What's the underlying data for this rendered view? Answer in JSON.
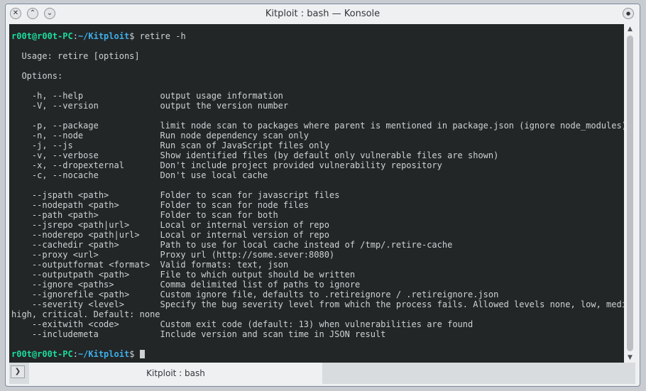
{
  "window": {
    "title": "Kitploit : bash — Konsole",
    "close_glyph": "✕",
    "minimize_glyph": "⌃",
    "maximize_glyph": "⌄",
    "keep_above_glyph": "●"
  },
  "prompt": {
    "user": "r00t@r00t-PC",
    "sep": ":",
    "path": "~/Kitploit",
    "symbol": "$",
    "command": "retire -h"
  },
  "output_lines": [
    "",
    "  Usage: retire [options]",
    "",
    "  Options:",
    "",
    "    -h, --help               output usage information",
    "    -V, --version            output the version number",
    "",
    "    -p, --package            limit node scan to packages where parent is mentioned in package.json (ignore node_modules)",
    "    -n, --node               Run node dependency scan only",
    "    -j, --js                 Run scan of JavaScript files only",
    "    -v, --verbose            Show identified files (by default only vulnerable files are shown)",
    "    -x, --dropexternal       Don't include project provided vulnerability repository",
    "    -c, --nocache            Don't use local cache",
    "",
    "    --jspath <path>          Folder to scan for javascript files",
    "    --nodepath <path>        Folder to scan for node files",
    "    --path <path>            Folder to scan for both",
    "    --jsrepo <path|url>      Local or internal version of repo",
    "    --noderepo <path|url>    Local or internal version of repo",
    "    --cachedir <path>        Path to use for local cache instead of /tmp/.retire-cache",
    "    --proxy <url>            Proxy url (http://some.sever:8080)",
    "    --outputformat <format>  Valid formats: text, json",
    "    --outputpath <path>      File to which output should be written",
    "    --ignore <paths>         Comma delimited list of paths to ignore",
    "    --ignorefile <path>      Custom ignore file, defaults to .retireignore / .retireignore.json",
    "    --severity <level>       Specify the bug severity level from which the process fails. Allowed levels none, low, medium,",
    "high, critical. Default: none",
    "    --exitwith <code>        Custom exit code (default: 13) when vulnerabilities are found",
    "    --includemeta            Include version and scan time in JSON result",
    ""
  ],
  "scrollbar": {
    "up_glyph": "▲",
    "down_glyph": "▼"
  },
  "tabs": {
    "menu_glyph": "❯",
    "items": [
      {
        "label": "Kitploit : bash"
      }
    ]
  }
}
